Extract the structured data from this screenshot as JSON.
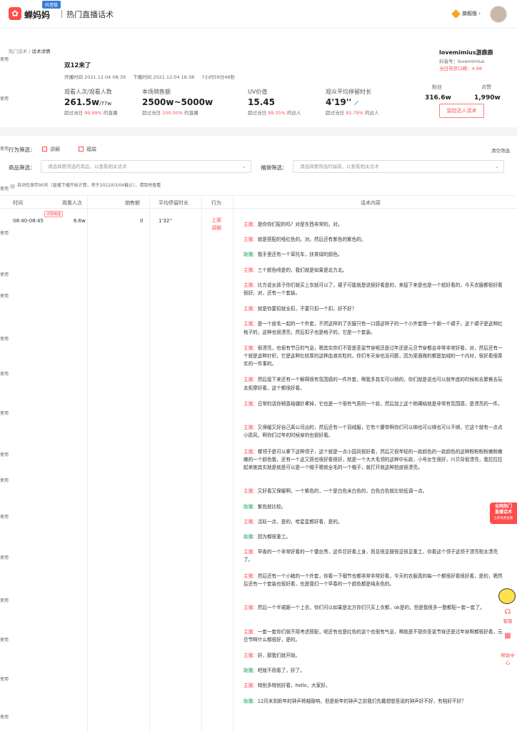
{
  "header": {
    "logo_icon": "app-logo",
    "brand": "蝉妈妈",
    "platform_badge": "抖音版",
    "page_heading": "热门直播话术",
    "member_label": "旗舰版",
    "avatar_icon": "user-avatar"
  },
  "watermark_text": "使用",
  "breadcrumb": {
    "parent": "热门话术 /",
    "current": "话术详情"
  },
  "live": {
    "title": "双12来了",
    "start": "开播时间  2021.12.04 08:39",
    "end": "下播时间  2021.12.04 16:38",
    "duration": "7小时59分46秒"
  },
  "stats": [
    {
      "label": "观看人次/观看人数",
      "value": "261.5w",
      "sub": "/77w",
      "cmp_prefix": "超过当日",
      "cmp_pct": "99.99%",
      "cmp_suffix": "的直播"
    },
    {
      "label": "本场销售额",
      "value": "2500w~5000w",
      "sub": "",
      "cmp_prefix": "超过当日",
      "cmp_pct": "100.00%",
      "cmp_suffix": "的直播"
    },
    {
      "label": "UV价值",
      "value": "15.45",
      "sub": "",
      "cmp_prefix": "超过当日",
      "cmp_pct": "99.35%",
      "cmp_suffix": "的达人"
    },
    {
      "label": "观众平均停留时长",
      "value": "4'19''",
      "sub": "",
      "cmp_prefix": "超过当日",
      "cmp_pct": "92.79%",
      "cmp_suffix": "的达人"
    }
  ],
  "anchor": {
    "name": "lovemimius游鹿鹿",
    "douyin_id": "抖音号：lovemimius",
    "score": "当日带货口碑：4.98",
    "fans_label": "粉丝",
    "fans_value": "316.6w",
    "likes_label": "点赞",
    "likes_value": "1,990w",
    "monitor_button": "监控达人话术"
  },
  "filters": {
    "behavior_label": "行为筛选：",
    "opt_explain": "讲解",
    "opt_bag": "福袋",
    "clear": "清空筛选",
    "product_label": "商品筛选：",
    "product_placeholder": "请选择要筛选的商品，以查看相关话术",
    "bag_label": "福袋筛选：",
    "bag_placeholder": "请选择要筛选的福袋，以查看相关话术"
  },
  "note": {
    "text": "自动仅保存90天（直播下播开始计算，将于2022/03/04截止），",
    "link": "请及时查看"
  },
  "table": {
    "headers": [
      "时间",
      "观看人次",
      "销售额",
      "平均停留时长",
      "行为",
      "话术内容"
    ],
    "row": {
      "time": "08:40-08:45",
      "hot_badge": "点赞峰值",
      "views": "6.6w",
      "sales": "0",
      "stay": "1'32''",
      "action": "上架\n讲解"
    }
  },
  "script_lines": [
    {
      "sp": "主播：",
      "t": "是你你们配的吗？对是东西非常的。对。"
    },
    {
      "sp": "主播：",
      "t": "就是搭配的哑红色的。对。然后还有紫色的紫色的。"
    },
    {
      "sp": "助播：",
      "t": "我手里还有一个草托车，扶茶绿的颜色。"
    },
    {
      "sp": "主播：",
      "t": "三个颜色喷是的，我们就是如果是北方北。"
    },
    {
      "sp": "主播：",
      "t": "比方说女孩子你们就买上衣就可以了，裙子可能就是说很好看是的，来接下来是也是一个超好看的，今天衣服都很好看很好，对，还有一个套装。"
    },
    {
      "sp": "主播：",
      "t": "就是你要扣就全扣，不要只扣一个扣，好不好？"
    },
    {
      "sp": "主播：",
      "t": "是一个皮毛一起的一个外套，不然这样的了衣服只有一口感这样子的一个小外套理一个跟一个裙子，这个裙子是这种红格子的，这种也很漂亮，然后扣子也是格子的，它是一个套装。"
    },
    {
      "sp": "主播：",
      "t": "很漂亮，也很有节日的气息，嗯其实你们不管是圣诞节穿呢还是过年还是元旦节穿都会非常非常好看，对，然后还有一个就是这种针织，它是这种比较厚的这种血液实粒的，你们冬天穿也没问题，因为里面做的都是加绒的一个内衬，很好看很厚实的一件事的。"
    },
    {
      "sp": "主播：",
      "t": "然后接下来还有一个解释很有氛围感的一件外套，啊我多其实可以稍的，你们就是说也可以就年底的时候和去聚餐去玩去拒摩好看，这个都很好看。"
    },
    {
      "sp": "主播：",
      "t": "日常的话你稍喜结绷针拿掉，它也是一个很有气质的一个款，然后加上这个稍裸结就是非常有氛围感，是漂亮的一件，"
    },
    {
      "sp": "主播：",
      "t": "又保暖又好自己离公司出的，然后还有一个羽绒服，它有个腰带啊你们可以绑也可以绑也可以不绑，它这个就有一点点小质风，啊你们过年的时候穿的也很好看。"
    },
    {
      "sp": "主播：",
      "t": "楼领子是可以拿下这种领子，这个就是一点小国风很好看，然后又很年轻的一款颜色的一款颜色的这种粉粉粉粉嫩粉嫩嫩的一个颜色我，还有一个这又搭也很好看很好，就是一个大大毛领的这种中长款，小号女生很好，川贝背很漂亮，我拉拉拉起来她其实就是就是可以是一个帽子嗯就全毛的一个帽子，就打开就这种拍皮很漂亮。"
    },
    {
      "sp": "主播：",
      "t": "又好看又保暖啊，一个紫色的，一个是白色米白色的，白色白色就比较低调一点。"
    },
    {
      "sp": "助播：",
      "t": "紫色就比较。"
    },
    {
      "sp": "主播：",
      "t": "活跃一点，是的，哇星星都好看，是的。"
    },
    {
      "sp": "助播：",
      "t": "因为都很重工。"
    },
    {
      "sp": "主播：",
      "t": "早香的一个非常好看的一个蕾丝秀，这件巨好看上身，而且很显瘦很显很显重工，你看这个领子这领子漂亮啦太漂亮了。"
    },
    {
      "sp": "主播：",
      "t": "然后还有一个小箱的一个外套，你看一下细节也都非常非常好看，今天的衣服真的每一个都很好看很好看，是的，嗯然后还有一个套装也很好看，也是我们一个早春的一个颜色都是纯永色的。"
    },
    {
      "sp": "主播：",
      "t": "然后一个半裙跟一个上衣，你们可以如果是北方你们只买上衣都，ok是的，但是我很多一整都配一套一套了。"
    },
    {
      "sp": "主播：",
      "t": "一套一套你们就不用考虑搭配，呢还有也是红色的这个也很有气息，啊就是不管你圣诞节穿还是过年穿啊都很好看，元旦节啊什么都很好，是的。"
    },
    {
      "sp": "主播：",
      "t": "好，那我们就开始。"
    },
    {
      "sp": "助播：",
      "t": "吧就不用看了，好了。"
    },
    {
      "sp": "主播：",
      "t": "特别多特别好看，hello，大家好。"
    },
    {
      "sp": "助播：",
      "t": "12月末到新年的钟声将越敲响，但是新年的钟声之前我们先戴想想圣诞的钟声好不好，有档好不好？"
    }
  ],
  "floating": {
    "hot_title": "全网热门",
    "hot_sub": "直播话术",
    "hot_small": "立即免费查看",
    "mascot_icon": "mascot",
    "service": "客服",
    "help": "帮助中心"
  },
  "colors": {
    "accent": "#ff4c4c",
    "assistant": "#1a9e5a"
  }
}
